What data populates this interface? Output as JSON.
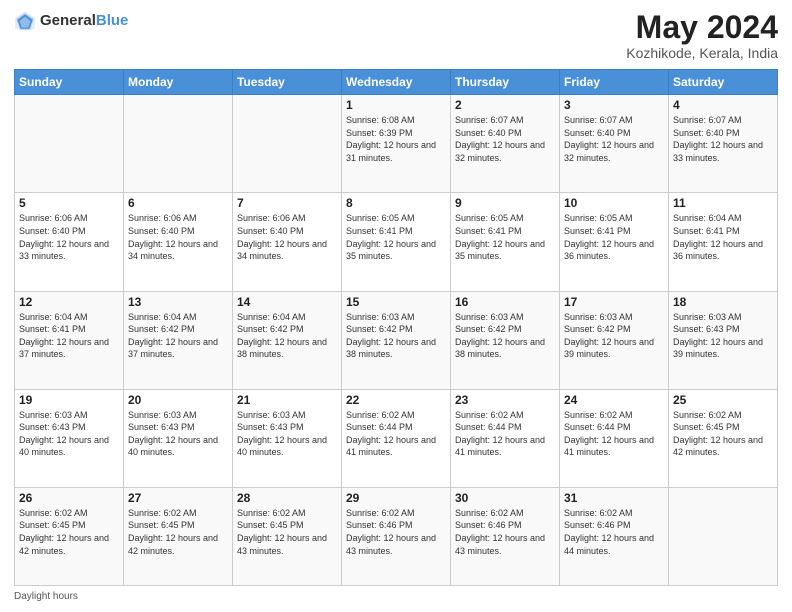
{
  "header": {
    "logo_general": "General",
    "logo_blue": "Blue",
    "title": "May 2024",
    "location": "Kozhikode, Kerala, India"
  },
  "weekdays": [
    "Sunday",
    "Monday",
    "Tuesday",
    "Wednesday",
    "Thursday",
    "Friday",
    "Saturday"
  ],
  "footer_label": "Daylight hours",
  "weeks": [
    [
      {
        "day": "",
        "sunrise": "",
        "sunset": "",
        "daylight": ""
      },
      {
        "day": "",
        "sunrise": "",
        "sunset": "",
        "daylight": ""
      },
      {
        "day": "",
        "sunrise": "",
        "sunset": "",
        "daylight": ""
      },
      {
        "day": "1",
        "sunrise": "Sunrise: 6:08 AM",
        "sunset": "Sunset: 6:39 PM",
        "daylight": "Daylight: 12 hours and 31 minutes."
      },
      {
        "day": "2",
        "sunrise": "Sunrise: 6:07 AM",
        "sunset": "Sunset: 6:40 PM",
        "daylight": "Daylight: 12 hours and 32 minutes."
      },
      {
        "day": "3",
        "sunrise": "Sunrise: 6:07 AM",
        "sunset": "Sunset: 6:40 PM",
        "daylight": "Daylight: 12 hours and 32 minutes."
      },
      {
        "day": "4",
        "sunrise": "Sunrise: 6:07 AM",
        "sunset": "Sunset: 6:40 PM",
        "daylight": "Daylight: 12 hours and 33 minutes."
      }
    ],
    [
      {
        "day": "5",
        "sunrise": "Sunrise: 6:06 AM",
        "sunset": "Sunset: 6:40 PM",
        "daylight": "Daylight: 12 hours and 33 minutes."
      },
      {
        "day": "6",
        "sunrise": "Sunrise: 6:06 AM",
        "sunset": "Sunset: 6:40 PM",
        "daylight": "Daylight: 12 hours and 34 minutes."
      },
      {
        "day": "7",
        "sunrise": "Sunrise: 6:06 AM",
        "sunset": "Sunset: 6:40 PM",
        "daylight": "Daylight: 12 hours and 34 minutes."
      },
      {
        "day": "8",
        "sunrise": "Sunrise: 6:05 AM",
        "sunset": "Sunset: 6:41 PM",
        "daylight": "Daylight: 12 hours and 35 minutes."
      },
      {
        "day": "9",
        "sunrise": "Sunrise: 6:05 AM",
        "sunset": "Sunset: 6:41 PM",
        "daylight": "Daylight: 12 hours and 35 minutes."
      },
      {
        "day": "10",
        "sunrise": "Sunrise: 6:05 AM",
        "sunset": "Sunset: 6:41 PM",
        "daylight": "Daylight: 12 hours and 36 minutes."
      },
      {
        "day": "11",
        "sunrise": "Sunrise: 6:04 AM",
        "sunset": "Sunset: 6:41 PM",
        "daylight": "Daylight: 12 hours and 36 minutes."
      }
    ],
    [
      {
        "day": "12",
        "sunrise": "Sunrise: 6:04 AM",
        "sunset": "Sunset: 6:41 PM",
        "daylight": "Daylight: 12 hours and 37 minutes."
      },
      {
        "day": "13",
        "sunrise": "Sunrise: 6:04 AM",
        "sunset": "Sunset: 6:42 PM",
        "daylight": "Daylight: 12 hours and 37 minutes."
      },
      {
        "day": "14",
        "sunrise": "Sunrise: 6:04 AM",
        "sunset": "Sunset: 6:42 PM",
        "daylight": "Daylight: 12 hours and 38 minutes."
      },
      {
        "day": "15",
        "sunrise": "Sunrise: 6:03 AM",
        "sunset": "Sunset: 6:42 PM",
        "daylight": "Daylight: 12 hours and 38 minutes."
      },
      {
        "day": "16",
        "sunrise": "Sunrise: 6:03 AM",
        "sunset": "Sunset: 6:42 PM",
        "daylight": "Daylight: 12 hours and 38 minutes."
      },
      {
        "day": "17",
        "sunrise": "Sunrise: 6:03 AM",
        "sunset": "Sunset: 6:42 PM",
        "daylight": "Daylight: 12 hours and 39 minutes."
      },
      {
        "day": "18",
        "sunrise": "Sunrise: 6:03 AM",
        "sunset": "Sunset: 6:43 PM",
        "daylight": "Daylight: 12 hours and 39 minutes."
      }
    ],
    [
      {
        "day": "19",
        "sunrise": "Sunrise: 6:03 AM",
        "sunset": "Sunset: 6:43 PM",
        "daylight": "Daylight: 12 hours and 40 minutes."
      },
      {
        "day": "20",
        "sunrise": "Sunrise: 6:03 AM",
        "sunset": "Sunset: 6:43 PM",
        "daylight": "Daylight: 12 hours and 40 minutes."
      },
      {
        "day": "21",
        "sunrise": "Sunrise: 6:03 AM",
        "sunset": "Sunset: 6:43 PM",
        "daylight": "Daylight: 12 hours and 40 minutes."
      },
      {
        "day": "22",
        "sunrise": "Sunrise: 6:02 AM",
        "sunset": "Sunset: 6:44 PM",
        "daylight": "Daylight: 12 hours and 41 minutes."
      },
      {
        "day": "23",
        "sunrise": "Sunrise: 6:02 AM",
        "sunset": "Sunset: 6:44 PM",
        "daylight": "Daylight: 12 hours and 41 minutes."
      },
      {
        "day": "24",
        "sunrise": "Sunrise: 6:02 AM",
        "sunset": "Sunset: 6:44 PM",
        "daylight": "Daylight: 12 hours and 41 minutes."
      },
      {
        "day": "25",
        "sunrise": "Sunrise: 6:02 AM",
        "sunset": "Sunset: 6:45 PM",
        "daylight": "Daylight: 12 hours and 42 minutes."
      }
    ],
    [
      {
        "day": "26",
        "sunrise": "Sunrise: 6:02 AM",
        "sunset": "Sunset: 6:45 PM",
        "daylight": "Daylight: 12 hours and 42 minutes."
      },
      {
        "day": "27",
        "sunrise": "Sunrise: 6:02 AM",
        "sunset": "Sunset: 6:45 PM",
        "daylight": "Daylight: 12 hours and 42 minutes."
      },
      {
        "day": "28",
        "sunrise": "Sunrise: 6:02 AM",
        "sunset": "Sunset: 6:45 PM",
        "daylight": "Daylight: 12 hours and 43 minutes."
      },
      {
        "day": "29",
        "sunrise": "Sunrise: 6:02 AM",
        "sunset": "Sunset: 6:46 PM",
        "daylight": "Daylight: 12 hours and 43 minutes."
      },
      {
        "day": "30",
        "sunrise": "Sunrise: 6:02 AM",
        "sunset": "Sunset: 6:46 PM",
        "daylight": "Daylight: 12 hours and 43 minutes."
      },
      {
        "day": "31",
        "sunrise": "Sunrise: 6:02 AM",
        "sunset": "Sunset: 6:46 PM",
        "daylight": "Daylight: 12 hours and 44 minutes."
      },
      {
        "day": "",
        "sunrise": "",
        "sunset": "",
        "daylight": ""
      }
    ]
  ]
}
